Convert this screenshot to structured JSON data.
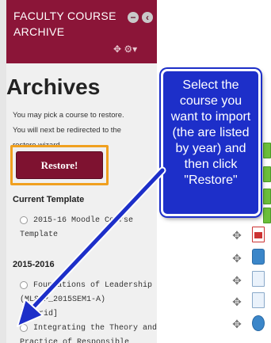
{
  "block": {
    "title": "FACULTY COURSE ARCHIVE",
    "minimize_glyph": "−",
    "collapse_glyph": "‹",
    "tools_glyph": "✥ ⚙▾"
  },
  "main": {
    "title": "Archives",
    "description_lines": [
      "You may pick a course to restore.",
      "You will next be redirected to the",
      "restore wizard."
    ],
    "restore_label": "Restore!",
    "sections": [
      {
        "heading": "Current Template",
        "items": [
          {
            "lines": [
              "2015-16 Moodle Course",
              "Template"
            ]
          }
        ]
      },
      {
        "heading": "2015-2016",
        "items": [
          {
            "lines": [
              "Foundations of Leadership",
              "(MLSHP_2015SEM1-A)",
              "[hybrid]"
            ]
          },
          {
            "lines": [
              "Integrating the Theory and",
              "Practice of Responsible"
            ]
          }
        ]
      }
    ]
  },
  "callout": {
    "text": "Select the course you want to import (the are listed by year) and then click \"Restore\"",
    "color": "#1d2fc9"
  },
  "right_column": {
    "icons": [
      "green-bar-icon",
      "green-bar-icon",
      "green-bar-icon",
      "green-bar-icon",
      "pdf-file-icon",
      "chat-icon",
      "document-icon",
      "document-icon",
      "globe-icon"
    ],
    "move_glyph": "✥"
  },
  "colors": {
    "brand": "#8b1538",
    "highlight_border": "#f0a020",
    "annotation": "#1d2fc9"
  }
}
